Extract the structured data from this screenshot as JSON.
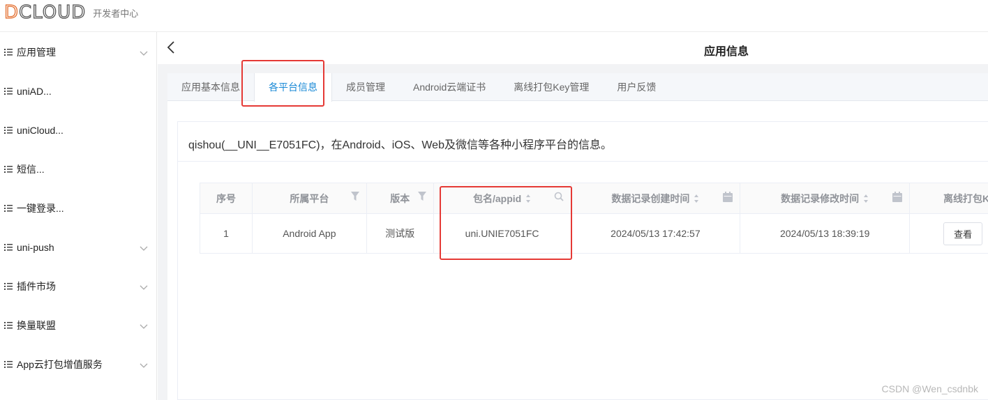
{
  "header": {
    "logo_text_d": "D",
    "logo_text_rest": "CLOUD",
    "subtitle": "开发者中心"
  },
  "sidebar": {
    "items": [
      {
        "label": "应用管理",
        "expandable": true
      },
      {
        "label": "uniAD...",
        "expandable": false
      },
      {
        "label": "uniCloud...",
        "expandable": false
      },
      {
        "label": "短信...",
        "expandable": false
      },
      {
        "label": "一键登录...",
        "expandable": false
      },
      {
        "label": "uni-push",
        "expandable": true
      },
      {
        "label": "插件市场",
        "expandable": true
      },
      {
        "label": "换量联盟",
        "expandable": true
      },
      {
        "label": "App云打包增值服务",
        "expandable": true
      }
    ]
  },
  "page": {
    "title": "应用信息"
  },
  "tabs": [
    {
      "label": "应用基本信息",
      "active": false
    },
    {
      "label": "各平台信息",
      "active": true
    },
    {
      "label": "成员管理",
      "active": false
    },
    {
      "label": "Android云端证书",
      "active": false
    },
    {
      "label": "离线打包Key管理",
      "active": false
    },
    {
      "label": "用户反馈",
      "active": false
    }
  ],
  "panel": {
    "description": "qishou(__UNI__E7051FC)，在Android、iOS、Web及微信等各种小程序平台的信息。"
  },
  "table": {
    "columns": [
      "序号",
      "所属平台",
      "版本",
      "包名/appid",
      "数据记录创建时间",
      "数据记录修改时间",
      "离线打包Key"
    ],
    "rows": [
      {
        "index": "1",
        "platform": "Android App",
        "version": "测试版",
        "appid": "uni.UNIE7051FC",
        "created": "2024/05/13 17:42:57",
        "modified": "2024/05/13 18:39:19",
        "action": "查看"
      }
    ]
  },
  "watermark": "CSDN @Wen_csdnbk",
  "colors": {
    "accent": "#1989d6",
    "highlight": "#e53935",
    "logo_d": "#e36b2a"
  }
}
